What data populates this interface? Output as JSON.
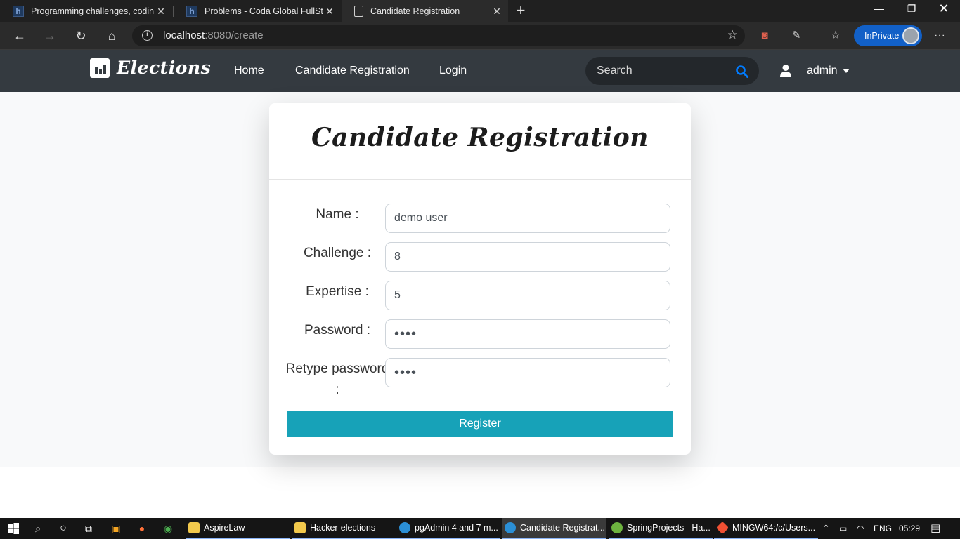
{
  "browser": {
    "tabs": [
      {
        "title": "Programming challenges, coding",
        "icon": "hackerearth-icon"
      },
      {
        "title": "Problems - Coda Global FullStack",
        "icon": "hackerearth-icon"
      },
      {
        "title": "Candidate Registration",
        "icon": "page-icon",
        "active": true
      }
    ],
    "url_host": "localhost",
    "url_rest": ":8080/create",
    "inprivate_label": "InPrivate"
  },
  "navbar": {
    "brand": "Elections",
    "links": [
      "Home",
      "Candidate Registration",
      "Login"
    ],
    "search_placeholder": "Search",
    "user": "admin"
  },
  "form": {
    "title": "Candidate Registration",
    "fields": [
      {
        "label": "Name :",
        "value": "demo user",
        "type": "text"
      },
      {
        "label": "Challenge :",
        "value": "8",
        "type": "text"
      },
      {
        "label": "Expertise :",
        "value": "5",
        "type": "text"
      },
      {
        "label": "Password :",
        "value": "demo",
        "type": "password"
      },
      {
        "label": "Retype password :",
        "value": "demo",
        "type": "password"
      }
    ],
    "submit_label": "Register"
  },
  "taskbar": {
    "apps": [
      {
        "name": "AspireLaw",
        "color": "#f2c94c"
      },
      {
        "name": "Hacker-elections",
        "color": "#f2c94c"
      },
      {
        "name": "pgAdmin 4 and 7 m...",
        "color": "#2b8fd6"
      },
      {
        "name": "Candidate Registrat...",
        "color": "#2b8fd6",
        "active": true
      },
      {
        "name": "SpringProjects - Ha...",
        "color": "#6db33f"
      },
      {
        "name": "MINGW64:/c/Users...",
        "color": "#f05033"
      }
    ],
    "language": "ENG",
    "time": "05:29"
  },
  "colors": {
    "navbar": "#343a40",
    "button": "#17a2b8",
    "search_icon": "#007bff",
    "inprivate": "#1260c7"
  }
}
